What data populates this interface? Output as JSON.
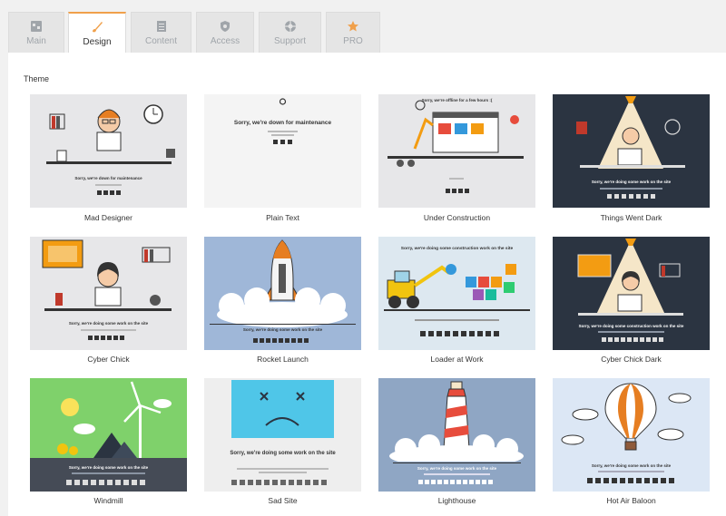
{
  "tabs": [
    {
      "label": "Main",
      "icon": "dashboard-icon"
    },
    {
      "label": "Design",
      "icon": "paintbrush-icon",
      "active": true
    },
    {
      "label": "Content",
      "icon": "document-icon"
    },
    {
      "label": "Access",
      "icon": "shield-icon"
    },
    {
      "label": "Support",
      "icon": "lifebuoy-icon"
    },
    {
      "label": "PRO",
      "icon": "star-icon"
    }
  ],
  "section": {
    "label": "Theme"
  },
  "colors": {
    "accent": "#f0a04b",
    "dark": "#2b3441",
    "sky": "#9fb7d8"
  },
  "themes": [
    {
      "name": "Mad Designer",
      "headline": "Sorry, we're down for maintenance"
    },
    {
      "name": "Plain Text",
      "headline": "Sorry, we're down for maintenance"
    },
    {
      "name": "Under Construction",
      "headline": "Sorry, we're offline for a few hours :("
    },
    {
      "name": "Things Went Dark",
      "headline": "Sorry, we're doing some work on the site"
    },
    {
      "name": "Cyber Chick",
      "headline": "Sorry, we're doing some work on the site"
    },
    {
      "name": "Rocket Launch",
      "headline": "Sorry, we're doing some work on the site"
    },
    {
      "name": "Loader at Work",
      "headline": "Sorry, we're doing some construction work on the site"
    },
    {
      "name": "Cyber Chick Dark",
      "headline": "Sorry, we're doing some construction work on the site"
    },
    {
      "name": "Windmill",
      "headline": "Sorry, we're doing some work on the site"
    },
    {
      "name": "Sad Site",
      "headline": "Sorry, we're doing some work on the site"
    },
    {
      "name": "Lighthouse",
      "headline": "Sorry, we're doing some work on the site"
    },
    {
      "name": "Hot Air Baloon",
      "headline": "Sorry, we're doing some work on the site"
    }
  ]
}
